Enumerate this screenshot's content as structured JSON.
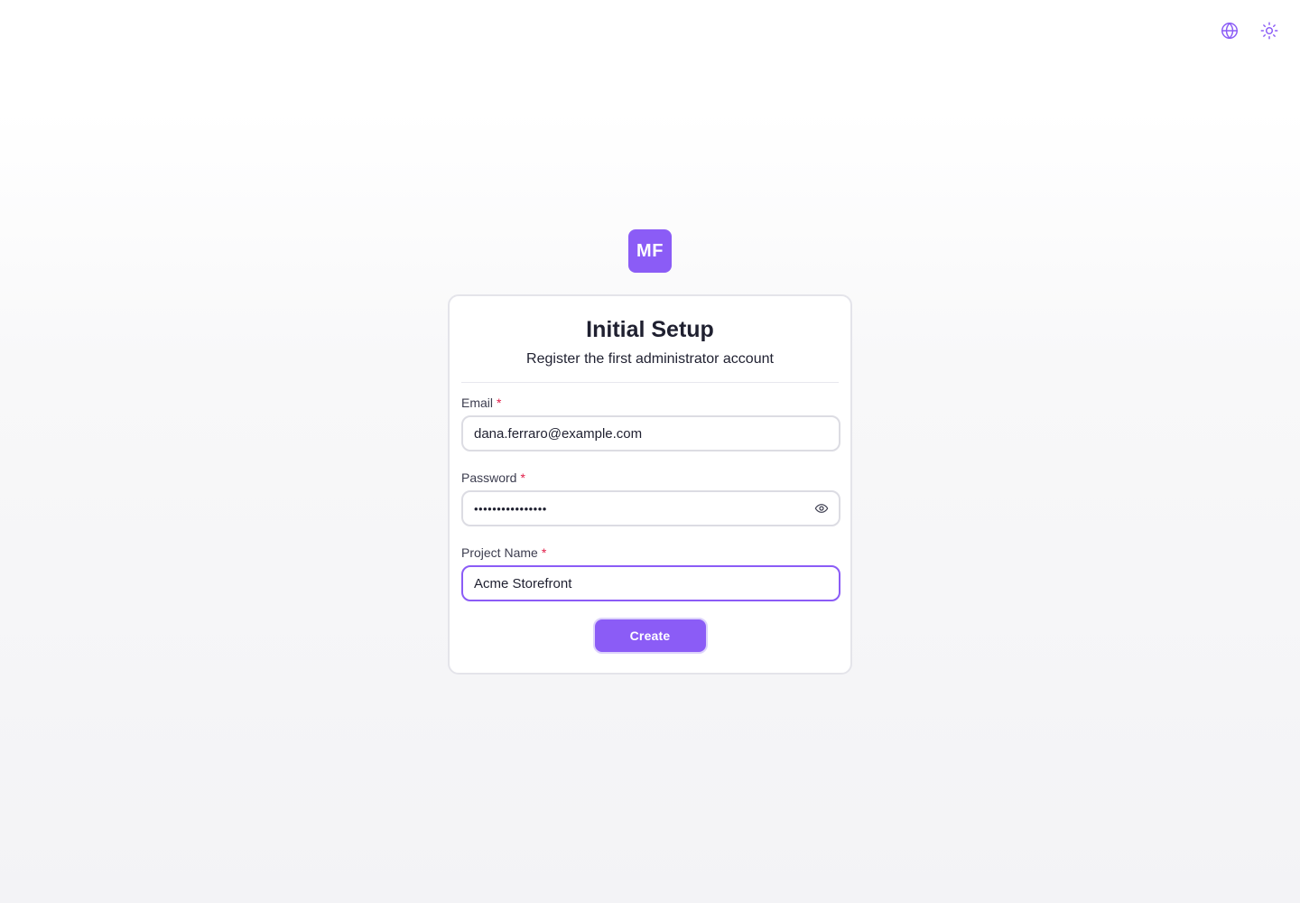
{
  "toolbar": {
    "language_icon": "globe-icon",
    "theme_icon": "sun-icon"
  },
  "logo": {
    "text": "MF",
    "color": "#8b5cf6"
  },
  "card": {
    "title": "Initial Setup",
    "subtitle": "Register the first administrator account"
  },
  "form": {
    "email": {
      "label": "Email",
      "required_mark": "*",
      "value": "dana.ferraro@example.com"
    },
    "password": {
      "label": "Password",
      "required_mark": "*",
      "value": "••••••••••••••••",
      "toggle_icon": "eye-icon"
    },
    "project_name": {
      "label": "Project Name",
      "required_mark": "*",
      "value": "Acme Storefront"
    },
    "submit_label": "Create"
  },
  "colors": {
    "accent": "#8b5cf6",
    "required": "#e11d48"
  }
}
